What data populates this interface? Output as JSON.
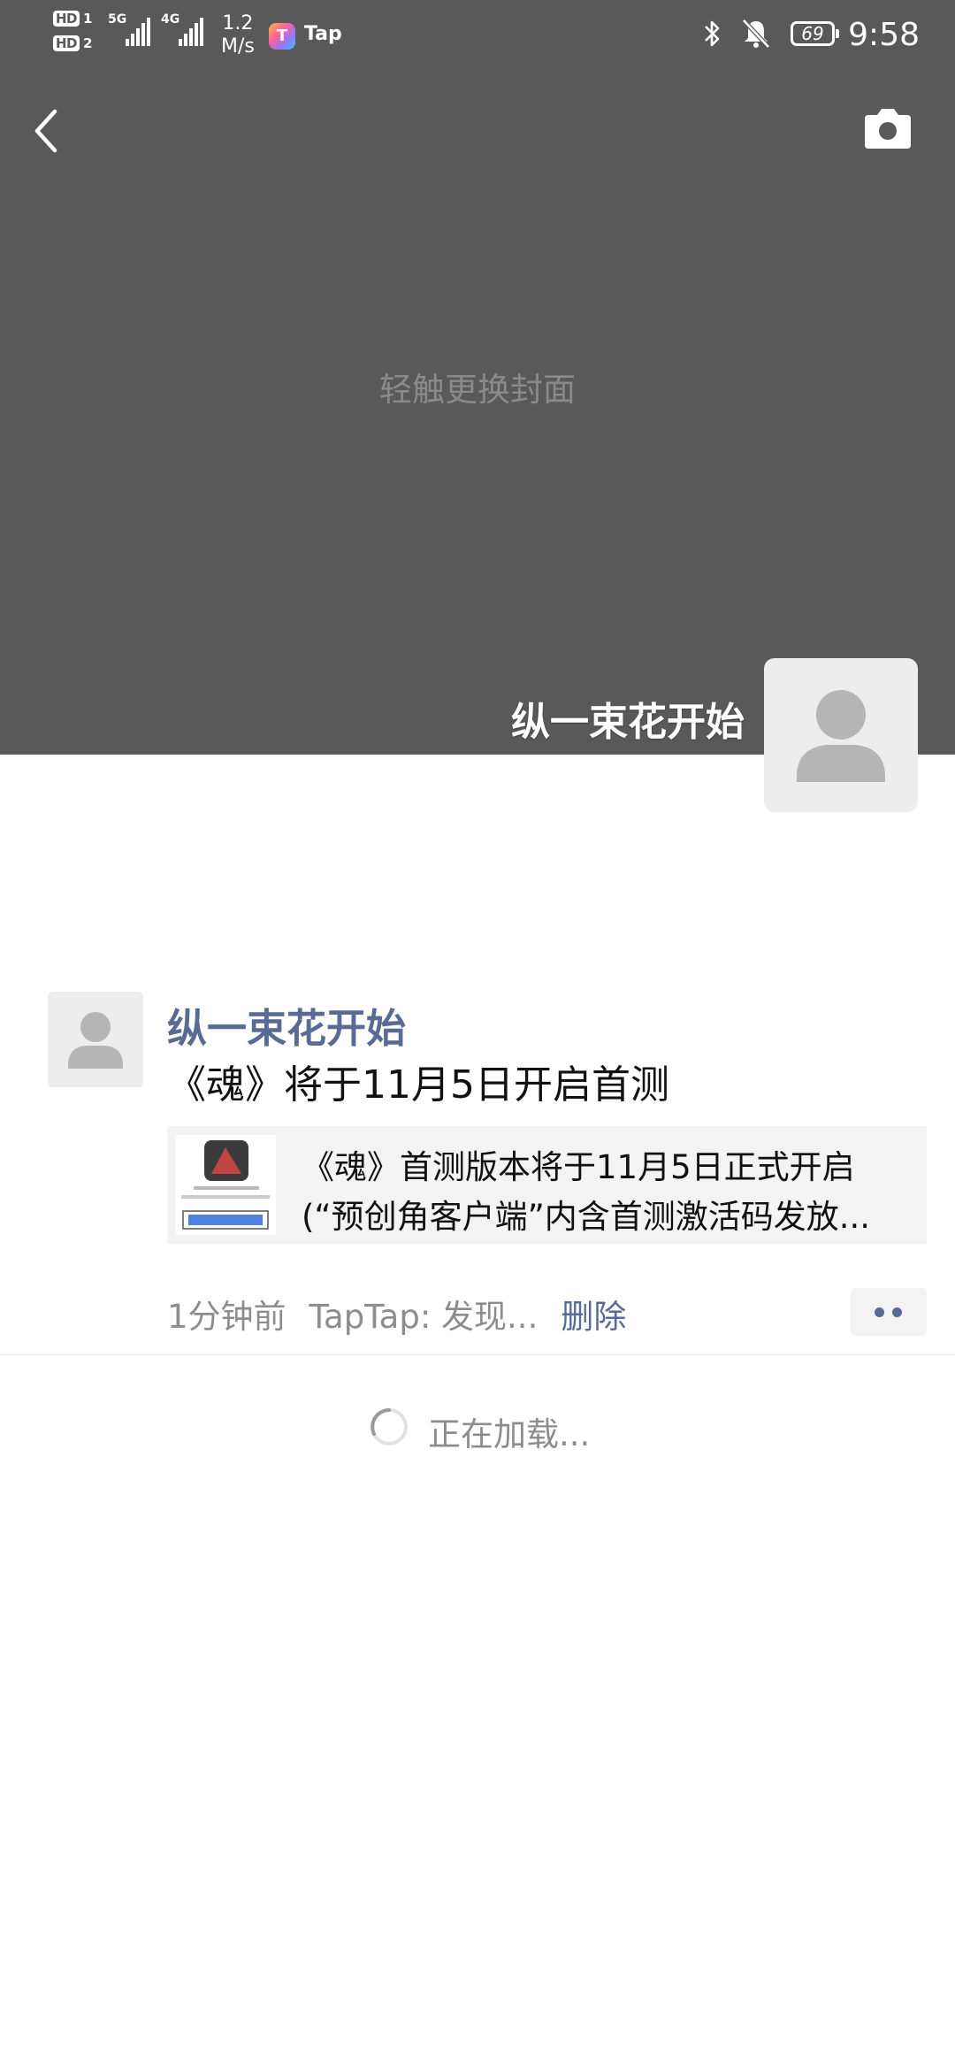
{
  "status_bar": {
    "hd_1": "HD",
    "sim_1": "1",
    "hd_2": "HD",
    "sim_2": "2",
    "network_1": "5G",
    "network_2": "4G",
    "speed_value": "1.2",
    "speed_unit": "M/s",
    "app_icon": "taptap-icon",
    "app_label": "Tap",
    "battery": "69",
    "time": "9:58"
  },
  "header": {
    "back_icon": "chevron-left-icon",
    "camera_icon": "camera-icon"
  },
  "cover": {
    "hint": "轻触更换封面"
  },
  "profile": {
    "name": "纵一束花开始",
    "avatar_icon": "default-avatar-icon"
  },
  "post": {
    "author": "纵一束花开始",
    "text": "《魂》将于11月5日开启首测",
    "link": {
      "line1": "《魂》首测版本将于11月5日正式开启",
      "line2": "(“预创角客户端”内含首测激活码发放..."
    },
    "time": "1分钟前",
    "source": "TapTap: 发现...",
    "delete_label": "删除"
  },
  "loading": {
    "text": "正在加载..."
  },
  "colors": {
    "cover_bg": "#595959",
    "link_blue": "#576b95",
    "meta_gray": "#8d8d8d"
  }
}
